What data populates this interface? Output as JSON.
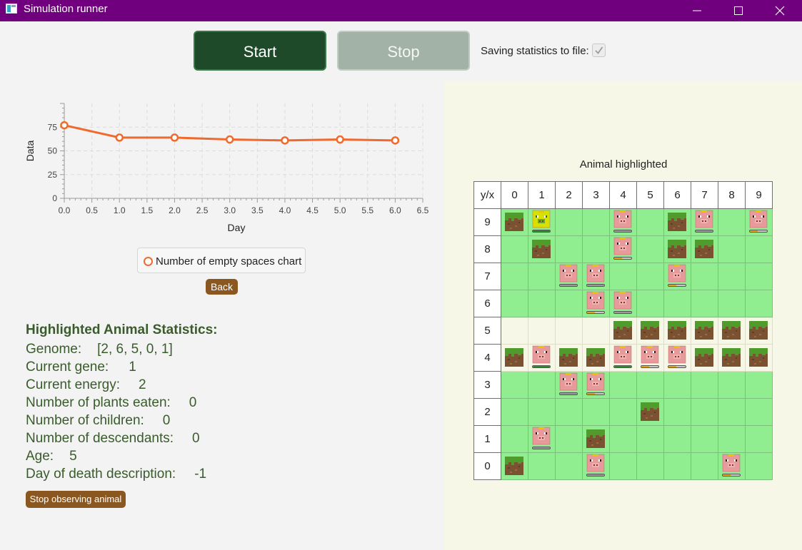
{
  "window": {
    "title": "Simulation runner"
  },
  "controls": {
    "start_label": "Start",
    "stop_label": "Stop",
    "saving_label": "Saving statistics to file:",
    "saving_checked": true
  },
  "chart_data": {
    "type": "line",
    "x": [
      0,
      1,
      2,
      3,
      4,
      5,
      6
    ],
    "series": [
      {
        "name": "Number of empty spaces chart",
        "values": [
          77,
          64,
          64,
          62,
          61,
          62,
          61
        ],
        "color": "#f06a2e"
      }
    ],
    "xlabel": "Day",
    "ylabel": "Data",
    "xlim": [
      0,
      6.5
    ],
    "ylim": [
      0,
      100
    ],
    "xticks": [
      0.0,
      0.5,
      1.0,
      1.5,
      2.0,
      2.5,
      3.0,
      3.5,
      4.0,
      4.5,
      5.0,
      5.5,
      6.0,
      6.5
    ],
    "yticks": [
      0,
      25,
      50,
      75
    ],
    "grid": true,
    "legend_position": "bottom"
  },
  "back_label": "Back",
  "stats": {
    "title": "Highlighted Animal Statistics:",
    "rows": [
      {
        "label": "Genome:",
        "value": "[2, 6, 5, 0, 1]"
      },
      {
        "label": "Current gene:",
        "value": "1"
      },
      {
        "label": "Current energy:",
        "value": "2"
      },
      {
        "label": "Number of plants eaten:",
        "value": "0"
      },
      {
        "label": "Number of children:",
        "value": "0"
      },
      {
        "label": "Number of descendants:",
        "value": "0"
      },
      {
        "label": "Age:",
        "value": "5"
      },
      {
        "label": "Day of death description:",
        "value": "-1"
      }
    ],
    "stop_observing_label": "Stop observing animal"
  },
  "grid": {
    "title": "Animal highlighted",
    "corner_label": "y/x",
    "columns": [
      "0",
      "1",
      "2",
      "3",
      "4",
      "5",
      "6",
      "7",
      "8",
      "9"
    ],
    "jungle_rows": [
      "5",
      "4"
    ],
    "colors": {
      "steppe": "#90ee90",
      "jungle": "#f7f7e8",
      "energy_high": "#2e8b2e",
      "energy_mid": "#e6a800",
      "energy_low": "#9a9a9a"
    },
    "rows": [
      {
        "y": "9",
        "cells": [
          "plant",
          "animal-highlighted:high",
          "",
          "",
          "animal:low",
          "",
          "plant",
          "animal:low",
          "",
          "animal:mid"
        ]
      },
      {
        "y": "8",
        "cells": [
          "",
          "plant",
          "",
          "",
          "animal:mid",
          "",
          "plant",
          "plant",
          "",
          ""
        ]
      },
      {
        "y": "7",
        "cells": [
          "",
          "",
          "animal:low",
          "animal:low",
          "",
          "",
          "animal:mid",
          "",
          "",
          ""
        ]
      },
      {
        "y": "6",
        "cells": [
          "",
          "",
          "",
          "animal:mid",
          "animal:low",
          "",
          "",
          "",
          "",
          ""
        ]
      },
      {
        "y": "5",
        "cells": [
          "",
          "",
          "",
          "",
          "plant",
          "plant",
          "plant",
          "plant",
          "plant",
          "plant"
        ]
      },
      {
        "y": "4",
        "cells": [
          "plant",
          "animal:high",
          "plant",
          "plant",
          "animal:high",
          "animal:mid",
          "animal:mid",
          "plant",
          "plant",
          "plant"
        ]
      },
      {
        "y": "3",
        "cells": [
          "",
          "",
          "animal:low",
          "animal:mid",
          "",
          "",
          "",
          "",
          "",
          ""
        ]
      },
      {
        "y": "2",
        "cells": [
          "",
          "",
          "",
          "",
          "",
          "plant",
          "",
          "",
          "",
          ""
        ]
      },
      {
        "y": "1",
        "cells": [
          "",
          "animal:low",
          "",
          "plant",
          "",
          "",
          "",
          "",
          "",
          ""
        ]
      },
      {
        "y": "0",
        "cells": [
          "plant",
          "",
          "",
          "animal:low",
          "",
          "",
          "",
          "",
          "animal:mid",
          ""
        ]
      }
    ]
  }
}
